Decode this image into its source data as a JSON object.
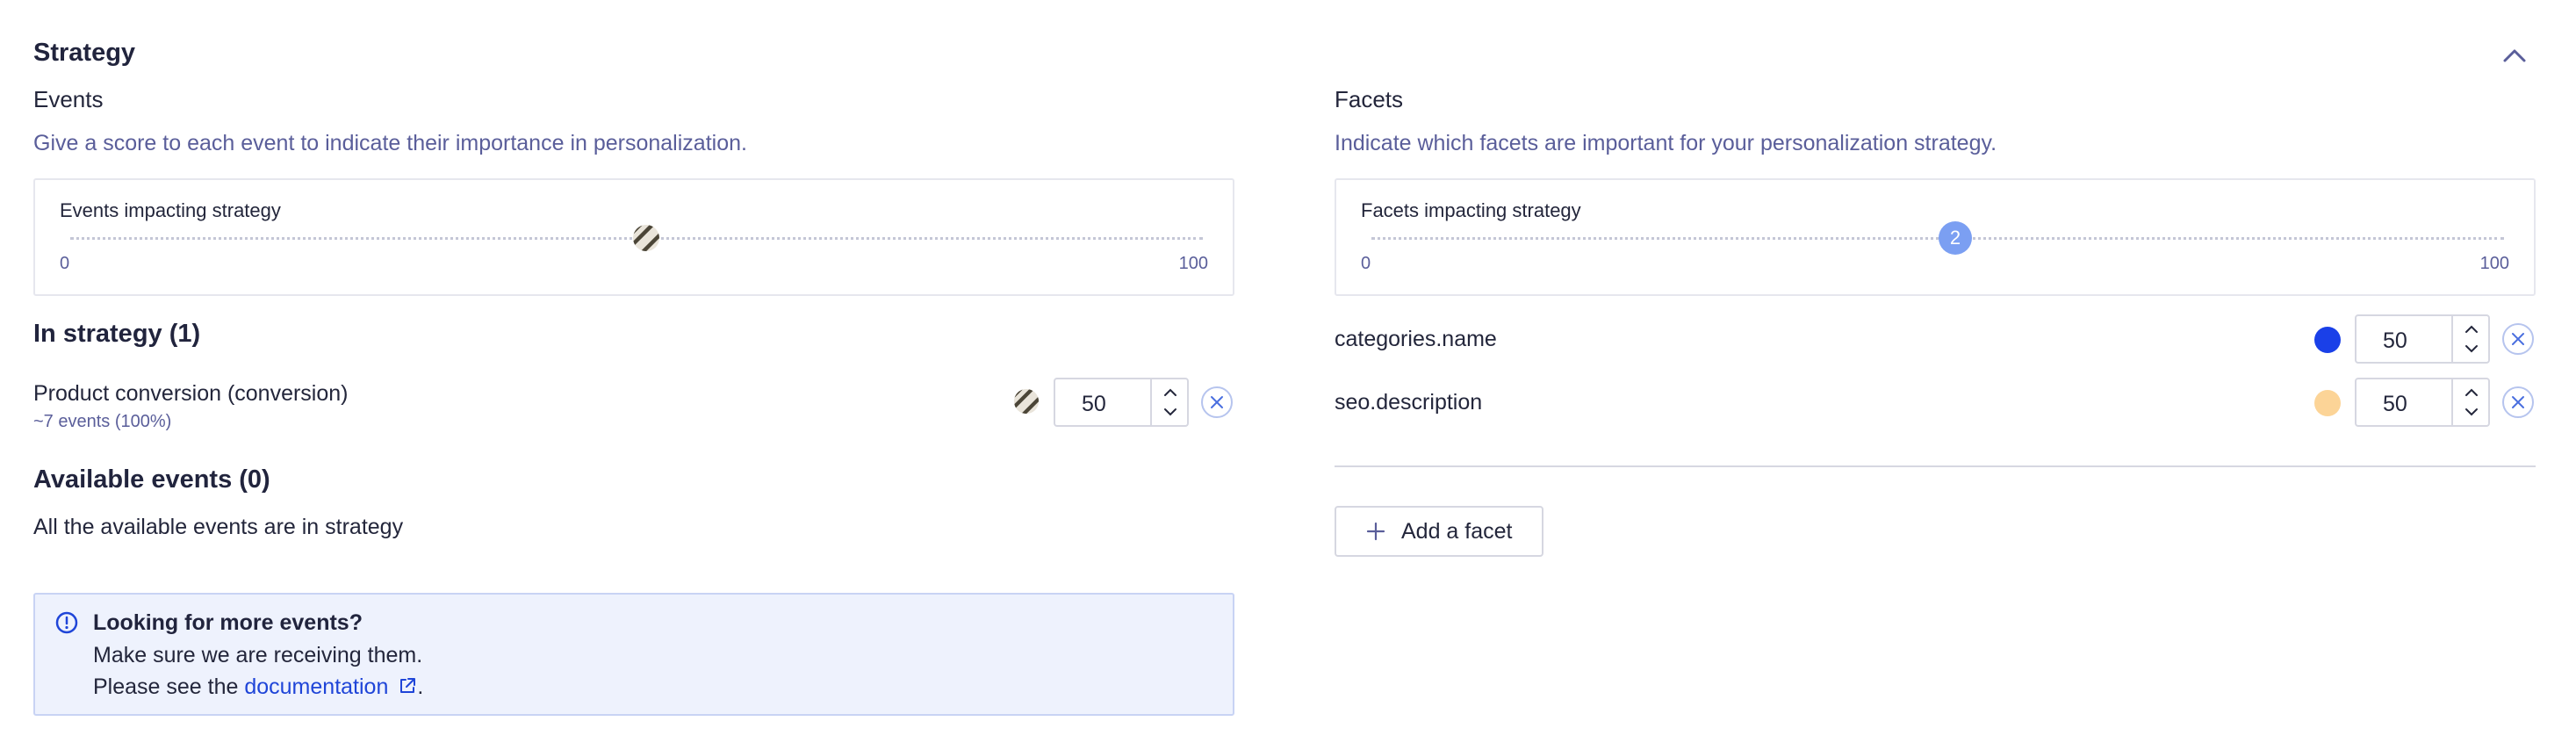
{
  "strategy": {
    "title": "Strategy"
  },
  "events": {
    "title": "Events",
    "description": "Give a score to each event to indicate their importance in personalization.",
    "slider": {
      "label": "Events impacting strategy",
      "min": "0",
      "max": "100",
      "value_fraction": 0.5
    },
    "in_strategy": {
      "title": "In strategy (1)",
      "items": [
        {
          "name": "Product conversion (conversion)",
          "meta": "~7 events (100%)",
          "score": "50"
        }
      ]
    },
    "available": {
      "title": "Available events (0)",
      "empty_text": "All the available events are in strategy"
    },
    "info": {
      "title": "Looking for more events?",
      "line2": "Make sure we are receiving them.",
      "line3_prefix": "Please see the ",
      "link_text": "documentation",
      "line3_suffix": "."
    }
  },
  "facets": {
    "title": "Facets",
    "description": "Indicate which facets are important for your personalization strategy.",
    "slider": {
      "label": "Facets impacting strategy",
      "min": "0",
      "max": "100",
      "handle_count": "2",
      "value_fraction": 0.5
    },
    "items": [
      {
        "name": "categories.name",
        "score": "50",
        "color": "#1a40e8"
      },
      {
        "name": "seo.description",
        "score": "50",
        "color": "#fcd497"
      }
    ],
    "add_button": "Add a facet"
  },
  "colors": {
    "accent": "#5a5e9a",
    "link": "#1f45d8",
    "handle": "#7b9ff2"
  }
}
